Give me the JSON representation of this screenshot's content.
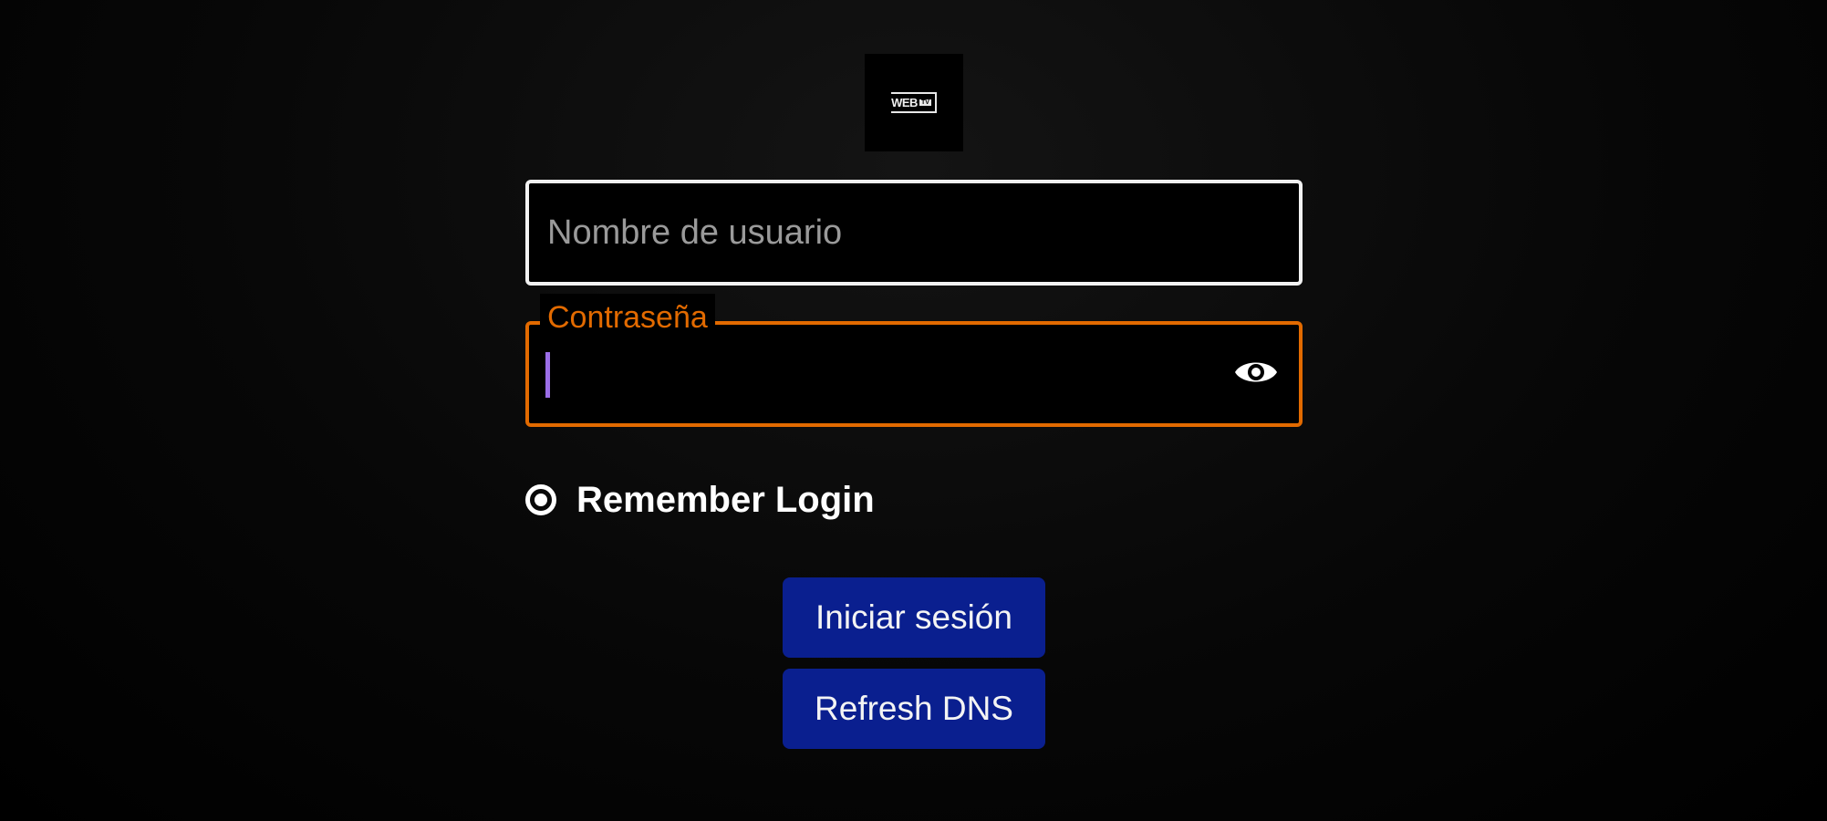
{
  "logo": {
    "word": "WEB",
    "sub": "TV"
  },
  "username": {
    "placeholder": "Nombre de usuario",
    "value": ""
  },
  "password": {
    "label": "Contraseña",
    "value": ""
  },
  "remember": {
    "label": "Remember Login",
    "checked": true
  },
  "buttons": {
    "login": "Iniciar sesión",
    "refresh_dns": "Refresh DNS"
  },
  "colors": {
    "accent": "#e26a00",
    "button": "#0a1f8f",
    "caret": "#9b6ee8",
    "background": "#000000"
  },
  "icons": {
    "password_toggle": "eye-icon",
    "remember": "radio-checked-icon"
  }
}
